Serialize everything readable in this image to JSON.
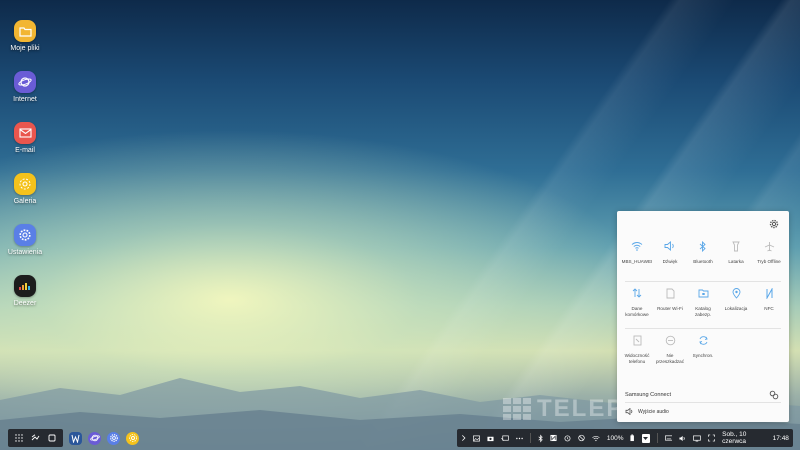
{
  "desktop": {
    "icons": [
      {
        "label": "Moje pliki",
        "icon": "folder-icon",
        "color": "#f2b632"
      },
      {
        "label": "Internet",
        "icon": "planet-icon",
        "color": "#6a5cd6"
      },
      {
        "label": "E-mail",
        "icon": "mail-icon",
        "color": "#e9564e"
      },
      {
        "label": "Galeria",
        "icon": "flower-icon",
        "color": "#f4c21c"
      },
      {
        "label": "Ustawienia",
        "icon": "gear-icon",
        "color": "#5a7fe6"
      },
      {
        "label": "Deezer",
        "icon": "equalizer-icon",
        "color": "#1d1d1d"
      }
    ]
  },
  "quick_panel": {
    "settings_icon": "gear-icon",
    "tiles": [
      {
        "label": "MBS_HUAWEI",
        "icon": "wifi-icon"
      },
      {
        "label": "Dźwięk",
        "icon": "speaker-icon"
      },
      {
        "label": "Bluetooth",
        "icon": "bluetooth-icon"
      },
      {
        "label": "Latarka",
        "icon": "flashlight-icon"
      },
      {
        "label": "Tryb Offline",
        "icon": "airplane-icon"
      },
      {
        "label": "Dane komórkowe",
        "icon": "data-arrows-icon"
      },
      {
        "label": "Router Wi-Fi",
        "icon": "hotspot-icon"
      },
      {
        "label": "Katalog zabezp.",
        "icon": "secure-folder-icon"
      },
      {
        "label": "Lokalizacja",
        "icon": "location-icon"
      },
      {
        "label": "NFC",
        "icon": "nfc-icon"
      },
      {
        "label": "Widoczność telefonu",
        "icon": "phone-visibility-icon"
      },
      {
        "label": "Nie przeszkadzać",
        "icon": "do-not-disturb-icon"
      },
      {
        "label": "Synchron.",
        "icon": "sync-icon"
      }
    ],
    "samsung_connect": "Samsung Connect",
    "audio_output": "Wyjście audio",
    "accent_color": "#5aa7e8"
  },
  "watermark": "TELEPOLIS.PL",
  "taskbar": {
    "left": {
      "apps": [
        "apps-grid-icon",
        "recent-icon",
        "home-icon"
      ],
      "pinned": [
        "word-icon",
        "internet-icon",
        "settings-icon",
        "gallery-icon"
      ]
    },
    "right": {
      "battery": "100%",
      "date": "Sob., 10 czerwca",
      "time": "17:48"
    }
  }
}
